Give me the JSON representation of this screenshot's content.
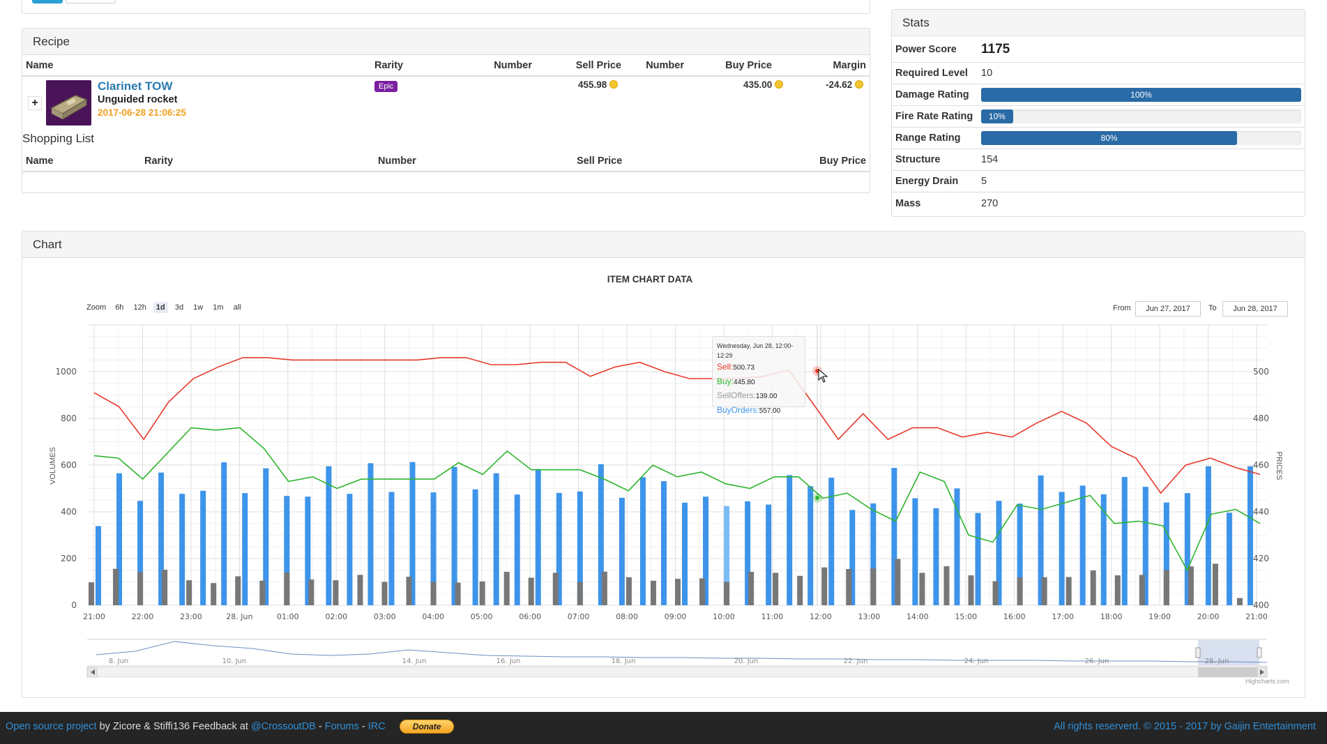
{
  "recipe": {
    "heading": "Recipe",
    "columns": [
      "Name",
      "Rarity",
      "Number",
      "Sell Price",
      "Number",
      "Buy Price",
      "Margin"
    ],
    "item": {
      "expand": "+",
      "name": "Clarinet TOW",
      "type": "Unguided rocket",
      "timestamp": "2017-06-28 21:06:25",
      "rarity": "Epic",
      "sell_price": "455.98",
      "buy_price": "435.00",
      "margin": "-24.62"
    },
    "shopping_title": "Shopping List",
    "shopping_columns": [
      "Name",
      "Rarity",
      "Number",
      "Sell Price",
      "Buy Price"
    ]
  },
  "stats": {
    "heading": "Stats",
    "power_label": "Power Score",
    "power_value": "1175",
    "level_label": "Required Level",
    "level_value": "10",
    "damage_label": "Damage Rating",
    "damage_text": "100%",
    "damage_pct": 100,
    "fire_label": "Fire Rate Rating",
    "fire_text": "10%",
    "fire_pct": 10,
    "range_label": "Range Rating",
    "range_text": "80%",
    "range_pct": 80,
    "structure_label": "Structure",
    "structure_value": "154",
    "energy_label": "Energy Drain",
    "energy_value": "5",
    "mass_label": "Mass",
    "mass_value": "270"
  },
  "chart_panel": {
    "heading": "Chart",
    "zoom_label": "Zoom",
    "zoom_buttons": [
      "6h",
      "12h",
      "1d",
      "3d",
      "1w",
      "1m",
      "all"
    ],
    "from_label": "From",
    "from_value": "Jun 27, 2017",
    "to_label": "To",
    "to_value": "Jun 28, 2017",
    "credit": "Highcharts.com",
    "tooltip": {
      "date": "Wednesday, Jun 28, 12:00-12:29",
      "sell_label": "Sell:",
      "sell_value": "500.73",
      "buy_label": "Buy:",
      "buy_value": "445.80",
      "sellofers_label": "SellOffers:",
      "sellofers_value": "139.00",
      "buyorders_label": "BuyOrders:",
      "buyorders_value": "557.00"
    },
    "navigator_labels": [
      "8. Jun",
      "10. Jun",
      "14. Jun",
      "16. Jun",
      "18. Jun",
      "20. Jun",
      "22. Jun",
      "24. Jun",
      "26. Jun",
      "28. Jun"
    ]
  },
  "chart_data": {
    "type": "line",
    "title": "ITEM CHART DATA",
    "xlabel": "",
    "y_left_label": "VOLUMES",
    "y_right_label": "PRICES",
    "y_left_ticks": [
      "0",
      "200",
      "400",
      "600",
      "800",
      "1000"
    ],
    "y_right_ticks": [
      "400",
      "420",
      "440",
      "460",
      "480",
      "500"
    ],
    "y_left_range": [
      0,
      1200
    ],
    "y_right_range": [
      400,
      520
    ],
    "x_ticks": [
      "21:00",
      "22:00",
      "23:00",
      "28. Jun",
      "01:00",
      "02:00",
      "03:00",
      "04:00",
      "05:00",
      "06:00",
      "07:00",
      "08:00",
      "09:00",
      "10:00",
      "11:00",
      "12:00",
      "13:00",
      "14:00",
      "15:00",
      "16:00",
      "17:00",
      "18:00",
      "19:00",
      "20:00",
      "21:00"
    ],
    "series": [
      {
        "name": "Sell",
        "color": "#e8392b",
        "axis": "right",
        "kind": "line",
        "values": [
          491,
          485,
          471,
          487,
          497,
          502,
          506,
          506,
          505,
          505,
          505,
          505,
          505,
          505,
          506,
          506,
          503,
          503,
          504,
          504,
          498,
          502,
          504,
          500,
          497,
          497,
          497,
          498,
          500.73,
          486,
          471,
          482,
          471,
          476,
          476,
          472,
          474,
          472,
          478,
          483,
          478,
          468,
          463,
          448,
          460,
          463,
          459,
          456
        ]
      },
      {
        "name": "Buy",
        "color": "#2db52d",
        "axis": "right",
        "kind": "line",
        "values": [
          464,
          463,
          454,
          465,
          476,
          475,
          476,
          467,
          453,
          455,
          450,
          454,
          454,
          454,
          454,
          461,
          456,
          466,
          458,
          458,
          458,
          454,
          449,
          460,
          455,
          457,
          452,
          450,
          455,
          455,
          445.8,
          448,
          441,
          436,
          457,
          453,
          430,
          427,
          443,
          441,
          444,
          447,
          435,
          436,
          434,
          415,
          439,
          441,
          435
        ]
      },
      {
        "name": "BuyOrders",
        "color": "#3d94ea",
        "axis": "left",
        "kind": "column",
        "values": [
          339,
          565,
          447,
          568,
          477,
          490,
          612,
          480,
          586,
          468,
          465,
          595,
          477,
          608,
          485,
          613,
          483,
          592,
          496,
          565,
          474,
          583,
          481,
          487,
          604,
          460,
          548,
          531,
          439,
          465,
          425,
          445,
          431,
          557,
          510,
          546,
          408,
          436,
          588,
          458,
          415,
          500,
          395,
          447,
          435,
          556,
          485,
          512,
          475,
          549,
          507,
          440,
          480,
          595,
          396,
          595
        ]
      },
      {
        "name": "SellOffers",
        "color": "#777777",
        "axis": "left",
        "kind": "column",
        "values": [
          98,
          156,
          142,
          152,
          107,
          95,
          124,
          105,
          140,
          110,
          107,
          130,
          100,
          122,
          100,
          97,
          102,
          143,
          118,
          139,
          100,
          144,
          120,
          105,
          113,
          115,
          100,
          143,
          139,
          126,
          162,
          155,
          158,
          198,
          139,
          167,
          128,
          103,
          119,
          120,
          121,
          149,
          128,
          130,
          150,
          166,
          178,
          31
        ]
      }
    ]
  },
  "footer": {
    "link1": "Open source project",
    "text1": " by Zicore & Stiffi136 Feedback at ",
    "link2": "@CrossoutDB",
    "sep1": " - ",
    "link3": "Forums",
    "sep2": " - ",
    "link4": "IRC",
    "donate": "Donate",
    "rights": "All rights reserverd. © 2015 - 2017 by Gaijin Entertainment"
  }
}
